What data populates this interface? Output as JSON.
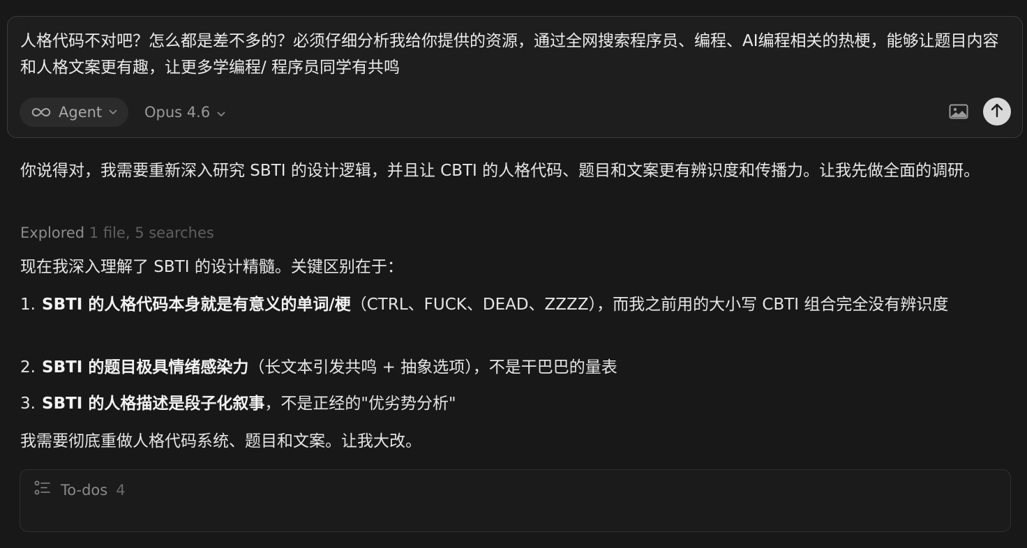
{
  "input": {
    "text": "人格代码不对吧？怎么都是差不多的？必须仔细分析我给你提供的资源，通过全网搜索程序员、编程、AI编程相关的热梗，能够让题目内容和人格文案更有趣，让更多学编程/ 程序员同学有共鸣",
    "mode_label": "Agent",
    "model_label": "Opus 4.6",
    "icons": {
      "mode": "infinity-icon",
      "dropdown": "chevron-down-icon",
      "image": "image-icon",
      "send": "arrow-up-icon"
    }
  },
  "response": {
    "intro": "你说得对，我需要重新深入研究 SBTI 的设计逻辑，并且让 CBTI 的人格代码、题目和文案更有辨识度和传播力。让我先做全面的调研。",
    "explored_label": "Explored",
    "explored_detail": "1 file, 5 searches",
    "lead": "现在我深入理解了 SBTI 的设计精髓。关键区别在于：",
    "items": [
      {
        "num": "1.",
        "bold": "SBTI 的人格代码本身就是有意义的单词/梗",
        "rest": "（CTRL、FUCK、DEAD、ZZZZ），而我之前用的大小写 CBTI 组合完全没有辨识度"
      },
      {
        "num": "2.",
        "bold": "SBTI 的题目极具情绪感染力",
        "rest": "（长文本引发共鸣 + 抽象选项），不是干巴巴的量表"
      },
      {
        "num": "3.",
        "bold": "SBTI 的人格描述是段子化叙事",
        "rest": "，不是正经的\"优劣势分析\""
      }
    ],
    "closing": "我需要彻底重做人格代码系统、题目和文案。让我大改。"
  },
  "todos": {
    "label": "To-dos",
    "count": "4",
    "icon": "checklist-icon"
  },
  "colors": {
    "background": "#181818",
    "text": "#e6e6e6",
    "muted": "#8c8c8c",
    "send_button": "#d9d9d9"
  }
}
